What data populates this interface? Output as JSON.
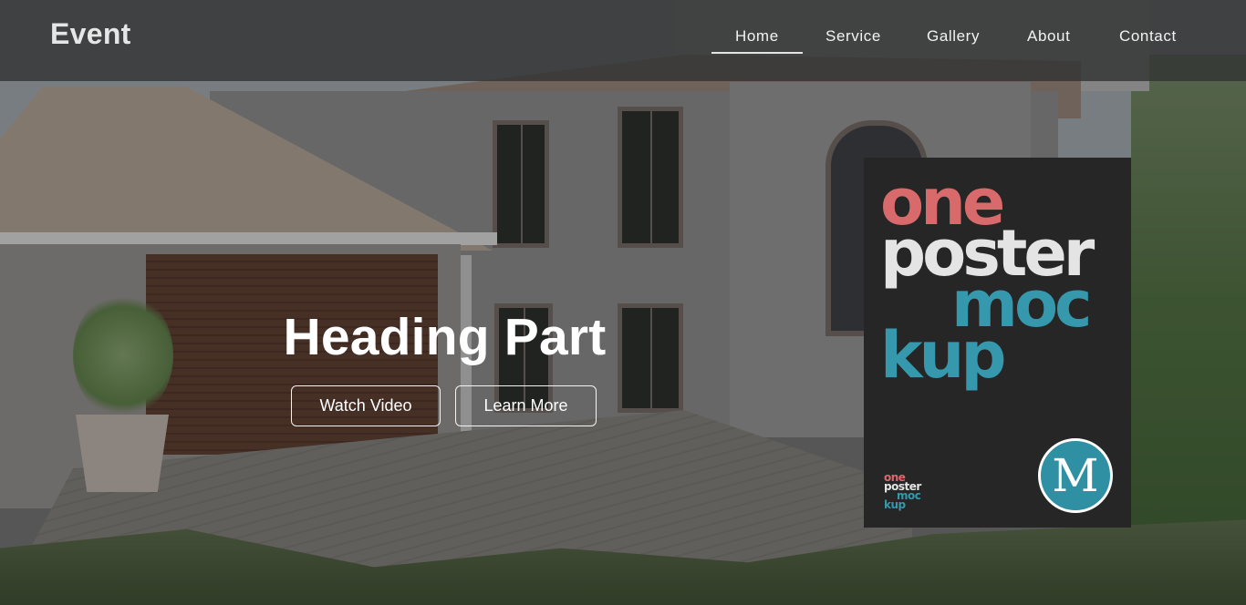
{
  "brand": "Event",
  "nav": {
    "items": [
      {
        "label": "Home",
        "active": true
      },
      {
        "label": "Service",
        "active": false
      },
      {
        "label": "Gallery",
        "active": false
      },
      {
        "label": "About",
        "active": false
      },
      {
        "label": "Contact",
        "active": false
      }
    ]
  },
  "hero": {
    "title": "Heading Part",
    "buttons": {
      "watch": "Watch Video",
      "learn": "Learn More"
    }
  },
  "poster": {
    "words": [
      "one",
      "poster",
      "moc",
      "kup"
    ],
    "small_words": [
      "one",
      "poster",
      "moc",
      "kup"
    ],
    "logo_letter": "M",
    "colors": {
      "one": "#d86a6c",
      "poster": "#e4e4e4",
      "mockup": "#3598ad",
      "background": "#262626"
    }
  },
  "colors": {
    "topbar": "#323434",
    "text": "#ffffff"
  }
}
